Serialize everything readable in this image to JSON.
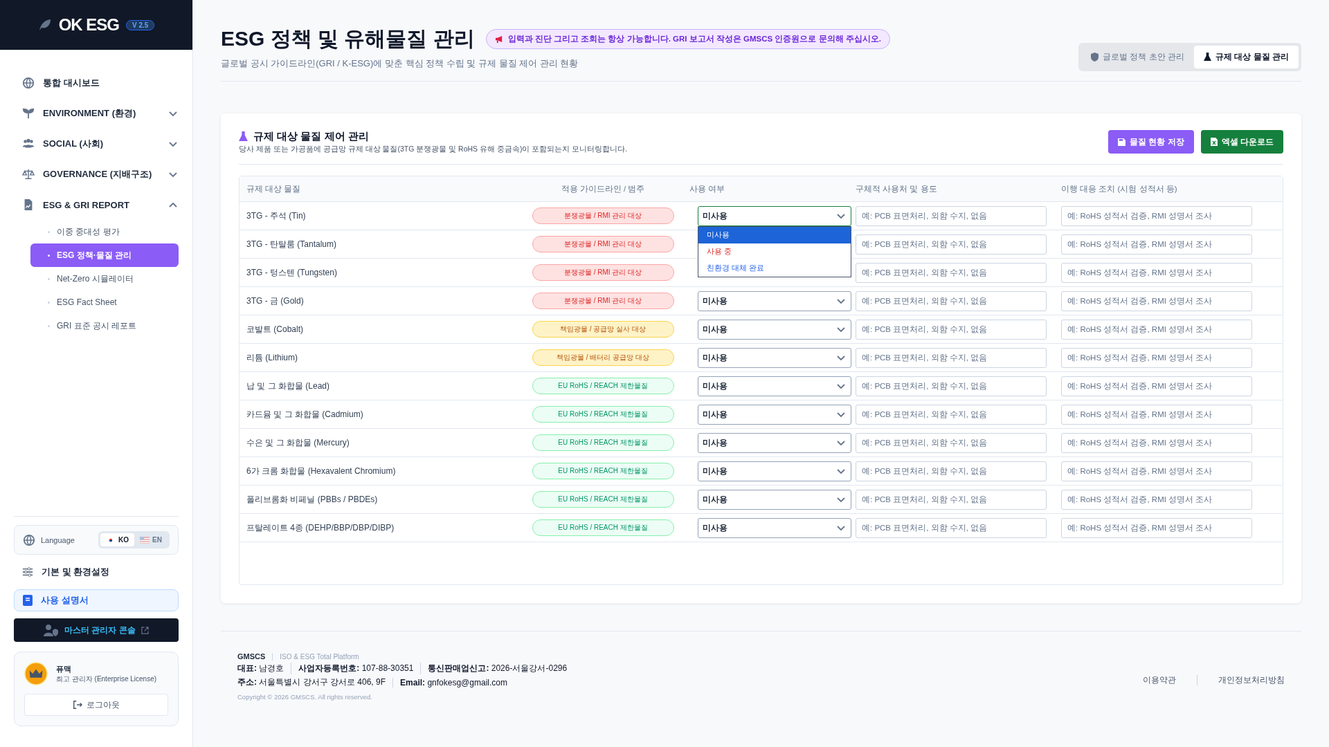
{
  "sidebar": {
    "logo": "OK ESG",
    "version": "V 2.5",
    "nav": [
      {
        "label": "통합 대시보드"
      },
      {
        "label": "ENVIRONMENT (환경)",
        "expanded": false
      },
      {
        "label": "SOCIAL (사회)",
        "expanded": false
      },
      {
        "label": "GOVERNANCE (지배구조)",
        "expanded": false
      },
      {
        "label": "ESG & GRI REPORT",
        "expanded": true,
        "children": [
          {
            "label": "이중 중대성 평가",
            "selected": false
          },
          {
            "label": "ESG 정책·물질 관리",
            "selected": true
          },
          {
            "label": "Net-Zero 시뮬레이터",
            "selected": false
          },
          {
            "label": "ESG Fact Sheet",
            "selected": false
          },
          {
            "label": "GRI 표준 공시 레포트",
            "selected": false
          }
        ]
      }
    ],
    "language": {
      "label": "Language",
      "options": [
        {
          "label": "KO",
          "selected": true
        },
        {
          "label": "EN",
          "selected": false
        }
      ]
    },
    "settings": "기본 및 환경설정",
    "manual": "사용 설명서",
    "admin": "마스터 관리자 콘솔",
    "user": {
      "name": "퓨맥",
      "role": "최고 관리자 (Enterprise License)"
    },
    "logout": "로그아웃"
  },
  "header": {
    "title": "ESG 정책 및 유해물질 관리",
    "notice": "입력과 진단 그리고 조회는 항상 가능합니다. GRI 보고서 작성은 GMSCS 인증원으로 문의해 주십시오.",
    "subtitle": "글로벌 공시 가이드라인(GRI / K-ESG)에 맞춘 핵심 정책 수립 및 규제 물질 제어 관리 현황",
    "tabs": [
      {
        "label": "글로벌 정책 초안 관리",
        "selected": false
      },
      {
        "label": "규제 대상 물질 관리",
        "selected": true
      }
    ]
  },
  "card": {
    "title": "규제 대상 물질 제어 관리",
    "description": "당사 제품 또는 가공품에 공급망 규제 대상 물질(3TG 분쟁광물 및 RoHS 유해 중금속)이 포함되는지 모니터링합니다.",
    "buttons": [
      {
        "label": "물질 현황 저장",
        "kind": "save"
      },
      {
        "label": "엑셀 다운로드",
        "kind": "excel"
      }
    ],
    "columns": [
      "규제 대상 물질",
      "적용 가이드라인 / 범주",
      "사용 여부",
      "구체적 사용처 및 용도",
      "이행 대응 조치 (시험 성적서 등)"
    ],
    "rows": [
      {
        "name": "3TG - 주석 (Tin)",
        "tag": "분쟁광물 / RMI 관리 대상",
        "kind": "conflict",
        "usage": "미사용",
        "detail": {
          "placeholder": "예: PCB 표면처리, 외함 수지, 없음"
        },
        "action": {
          "placeholder": "예: RoHS 성적서 검증, RMI 성명서 조사"
        },
        "open": true,
        "options": [
          {
            "label": "미사용",
            "kind": "unused",
            "selected": true
          },
          {
            "label": "사용 중",
            "kind": "in_use",
            "selected": false
          },
          {
            "label": "친환경 대체 완료",
            "kind": "replaced",
            "selected": false
          }
        ]
      },
      {
        "name": "3TG - 탄탈룸 (Tantalum)",
        "tag": "분쟁광물 / RMI 관리 대상",
        "kind": "conflict",
        "detail": {
          "placeholder": "예: PCB 표면처리, 외함 수지, 없음"
        },
        "action": {
          "placeholder": "예: RoHS 성적서 검증, RMI 성명서 조사"
        }
      },
      {
        "name": "3TG - 텅스텐 (Tungsten)",
        "tag": "분쟁광물 / RMI 관리 대상",
        "kind": "conflict",
        "detail": {
          "placeholder": "예: PCB 표면처리, 외함 수지, 없음"
        },
        "action": {
          "placeholder": "예: RoHS 성적서 검증, RMI 성명서 조사"
        }
      },
      {
        "name": "3TG - 금 (Gold)",
        "tag": "분쟁광물 / RMI 관리 대상",
        "kind": "conflict",
        "usage": "미사용",
        "detail": {
          "placeholder": "예: PCB 표면처리, 외함 수지, 없음"
        },
        "action": {
          "placeholder": "예: RoHS 성적서 검증, RMI 성명서 조사"
        }
      },
      {
        "name": "코발트 (Cobalt)",
        "tag": "책임광물 / 공급망 실사 대상",
        "kind": "responsible",
        "usage": "미사용",
        "detail": {
          "placeholder": "예: PCB 표면처리, 외함 수지, 없음"
        },
        "action": {
          "placeholder": "예: RoHS 성적서 검증, RMI 성명서 조사"
        }
      },
      {
        "name": "리튬 (Lithium)",
        "tag": "책임광물 / 배터리 공급망 대상",
        "kind": "responsible",
        "usage": "미사용",
        "detail": {
          "placeholder": "예: PCB 표면처리, 외함 수지, 없음"
        },
        "action": {
          "placeholder": "예: RoHS 성적서 검증, RMI 성명서 조사"
        }
      },
      {
        "name": "납 및 그 화합물 (Lead)",
        "tag": "EU RoHS / REACH 제한물질",
        "kind": "restricted",
        "usage": "미사용",
        "detail": {
          "placeholder": "예: PCB 표면처리, 외함 수지, 없음"
        },
        "action": {
          "placeholder": "예: RoHS 성적서 검증, RMI 성명서 조사"
        }
      },
      {
        "name": "카드뮴 및 그 화합물 (Cadmium)",
        "tag": "EU RoHS / REACH 제한물질",
        "kind": "restricted",
        "usage": "미사용",
        "detail": {
          "placeholder": "예: PCB 표면처리, 외함 수지, 없음"
        },
        "action": {
          "placeholder": "예: RoHS 성적서 검증, RMI 성명서 조사"
        }
      },
      {
        "name": "수은 및 그 화합물 (Mercury)",
        "tag": "EU RoHS / REACH 제한물질",
        "kind": "restricted",
        "usage": "미사용",
        "detail": {
          "placeholder": "예: PCB 표면처리, 외함 수지, 없음"
        },
        "action": {
          "placeholder": "예: RoHS 성적서 검증, RMI 성명서 조사"
        }
      },
      {
        "name": "6가 크롬 화합물 (Hexavalent Chromium)",
        "tag": "EU RoHS / REACH 제한물질",
        "kind": "restricted",
        "usage": "미사용",
        "detail": {
          "placeholder": "예: PCB 표면처리, 외함 수지, 없음"
        },
        "action": {
          "placeholder": "예: RoHS 성적서 검증, RMI 성명서 조사"
        }
      },
      {
        "name": "폴리브롬화 비페닐 (PBBs / PBDEs)",
        "tag": "EU RoHS / REACH 제한물질",
        "kind": "restricted",
        "usage": "미사용",
        "detail": {
          "placeholder": "예: PCB 표면처리, 외함 수지, 없음"
        },
        "action": {
          "placeholder": "예: RoHS 성적서 검증, RMI 성명서 조사"
        }
      },
      {
        "name": "프탈레이트 4종 (DEHP/BBP/DBP/DIBP)",
        "tag": "EU RoHS / REACH 제한물질",
        "kind": "restricted",
        "usage": "미사용",
        "detail": {
          "placeholder": "예: PCB 표면처리, 외함 수지, 없음"
        },
        "action": {
          "placeholder": "예: RoHS 성적서 검증, RMI 성명서 조사"
        }
      }
    ]
  },
  "footer": {
    "company": "GMSCS",
    "tagline": "ISO & ESG Total Platform",
    "info": [
      [
        {
          "label": "대표:",
          "value": "남경호"
        },
        {
          "label": "사업자등록번호:",
          "value": "107-88-30351"
        },
        {
          "label": "통신판매업신고:",
          "value": "2026-서울강서-0296"
        }
      ],
      [
        {
          "label": "주소:",
          "value": "서울특별시 강서구 강서로 406, 9F"
        },
        {
          "label": "Email:",
          "value": "gnfokesg@gmail.com"
        }
      ]
    ],
    "copyright": "Copyright © 2026 GMSCS. All rights reserved.",
    "links": [
      "이용약관",
      "개인정보처리방침"
    ]
  }
}
